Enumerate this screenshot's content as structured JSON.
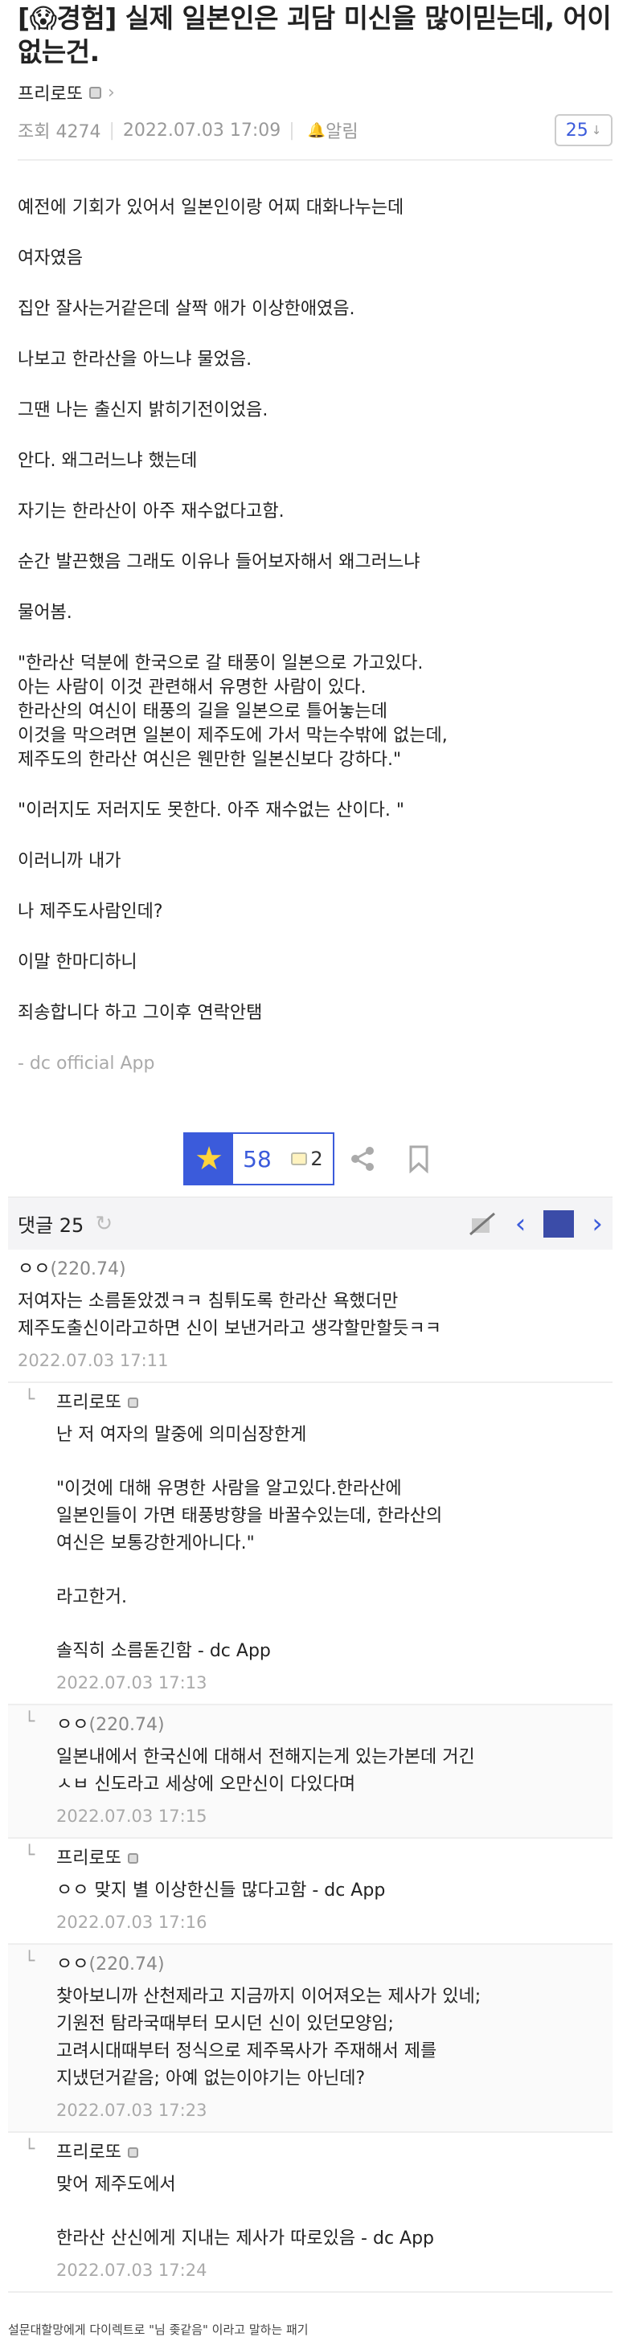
{
  "post": {
    "tag": "[😱경험]",
    "title": "실제 일본인은 괴담 미신을 많이믿는데, 어이없는건.",
    "author": "프리로또",
    "views_label": "조회 4274",
    "date": "2022.07.03 17:09",
    "alarm_label": "알림",
    "comment_count_box": "25",
    "body": [
      "예전에 기회가 있어서 일본인이랑 어찌 대화나누는데",
      "여자였음",
      "집안 잘사는거같은데 살짝 애가 이상한애였음.",
      "나보고 한라산을 아느냐 물었음.",
      "그땐 나는 출신지 밝히기전이었음.",
      "안다. 왜그러느냐 했는데",
      "자기는 한라산이 아주 재수없다고함.",
      "순간 발끈했음 그래도 이유나 들어보자해서 왜그러느냐",
      "물어봄.",
      "\"한라산 덕분에 한국으로 갈 태풍이 일본으로 가고있다.\n아는 사람이 이것 관련해서 유명한 사람이 있다.\n한라산의 여신이 태풍의 길을 일본으로 틀어놓는데\n이것을 막으려면 일본이 제주도에 가서 막는수밖에 없는데,\n제주도의 한라산 여신은 웬만한 일본신보다 강하다.\"",
      "\"이러지도 저러지도 못한다. 아주 재수없는 산이다. \"",
      "이러니까 내가",
      "나 제주도사람인데?",
      "이말 한마디하니",
      "죄송합니다 하고 그이후 연락안탬"
    ],
    "signature": "- dc official App"
  },
  "recommend": {
    "count": "58",
    "nonrec_count": "2"
  },
  "comments_bar": {
    "label": "댓글 25"
  },
  "comments": [
    {
      "type": "comment",
      "nick": "ㅇㅇ",
      "ip": "(220.74)",
      "text": "저여자는 소름돋았겠ㅋㅋ 침튀도록 한라산 욕했더만\n제주도출신이라고하면 신이 보낸거라고 생각할만할듯ㅋㅋ",
      "date": "2022.07.03 17:11"
    },
    {
      "type": "reply",
      "nick": "프리로또",
      "paras": [
        "난 저 여자의 말중에 의미심장한게",
        "\"이것에 대해 유명한 사람을 알고있다.한라산에\n일본인들이 가면 태풍방향을 바꿀수있는데, 한라산의\n여신은 보통강한게아니다.\"",
        "라고한거.",
        "솔직히 소름돋긴함 - dc App"
      ],
      "date": "2022.07.03 17:13"
    },
    {
      "type": "reply",
      "nick": "ㅇㅇ",
      "ip": "(220.74)",
      "paras": [
        "일본내에서 한국신에 대해서 전해지는게 있는가본데 거긴\nㅅㅂ 신도라고 세상에 오만신이 다있다며"
      ],
      "date": "2022.07.03 17:15"
    },
    {
      "type": "reply",
      "nick": "프리로또",
      "paras": [
        "ㅇㅇ 맞지 별 이상한신들 많다고함 - dc App"
      ],
      "date": "2022.07.03 17:16"
    },
    {
      "type": "reply",
      "nick": "ㅇㅇ",
      "ip": "(220.74)",
      "paras": [
        "찾아보니까 산천제라고 지금까지 이어져오는 제사가 있네;\n기원전 탐라국때부터 모시던 신이 있던모양임;\n고려시대때부터 정식으로 제주목사가 주재해서 제를\n지냈던거같음; 아예 없는이야기는 아닌데?"
      ],
      "date": "2022.07.03 17:23"
    },
    {
      "type": "reply",
      "nick": "프리로또",
      "paras": [
        "맞어 제주도에서",
        "한라산 산신에게 지내는 제사가 따로있음 - dc App"
      ],
      "date": "2022.07.03 17:24"
    }
  ],
  "footer_note": "설문대할망에게 다이렉트로 \"님 좆같음\" 이라고 말하는 패기",
  "colors": {
    "accent": "#3b5bdb",
    "star": "#ffd43b",
    "muted": "#aaaaaa"
  }
}
